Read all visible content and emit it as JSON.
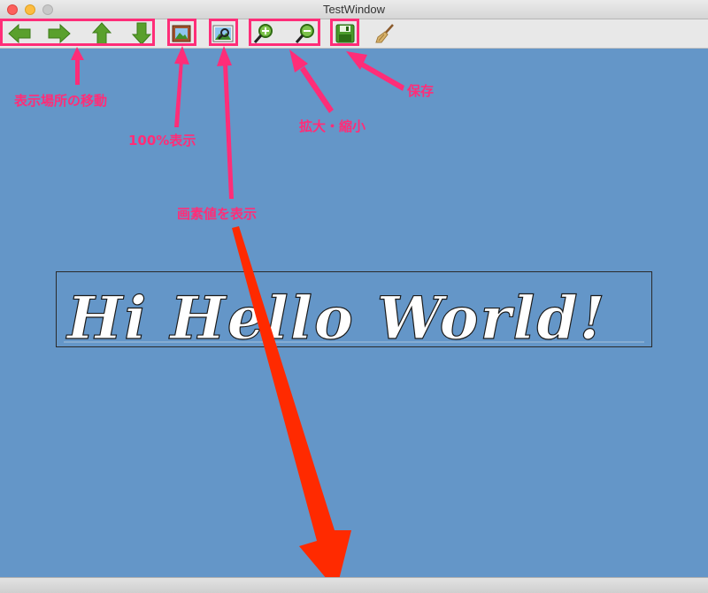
{
  "window": {
    "title": "TestWindow"
  },
  "toolbar": {
    "buttons": [
      {
        "name": "move-left",
        "icon": "arrow-left-icon"
      },
      {
        "name": "move-right",
        "icon": "arrow-right-icon"
      },
      {
        "name": "move-up",
        "icon": "arrow-up-icon"
      },
      {
        "name": "move-down",
        "icon": "arrow-down-icon"
      },
      {
        "name": "fit-100",
        "icon": "picture-icon"
      },
      {
        "name": "pixel-value",
        "icon": "picture-magnifier-icon"
      },
      {
        "name": "zoom-in",
        "icon": "zoom-in-icon"
      },
      {
        "name": "zoom-out",
        "icon": "zoom-out-icon"
      },
      {
        "name": "save",
        "icon": "floppy-disk-icon"
      },
      {
        "name": "clear",
        "icon": "broom-icon"
      }
    ]
  },
  "image": {
    "text": "Hi Hello World!"
  },
  "annotations": {
    "move": "表示場所の移動",
    "fit100": "100%表示",
    "pixel": "画素値を表示",
    "zoom": "拡大・縮小",
    "save": "保存"
  },
  "colors": {
    "background": "#6496c8",
    "annotation": "#ff2d78",
    "arrow_icon_green": "#5aa02c",
    "big_arrow": "#ff2a00"
  }
}
